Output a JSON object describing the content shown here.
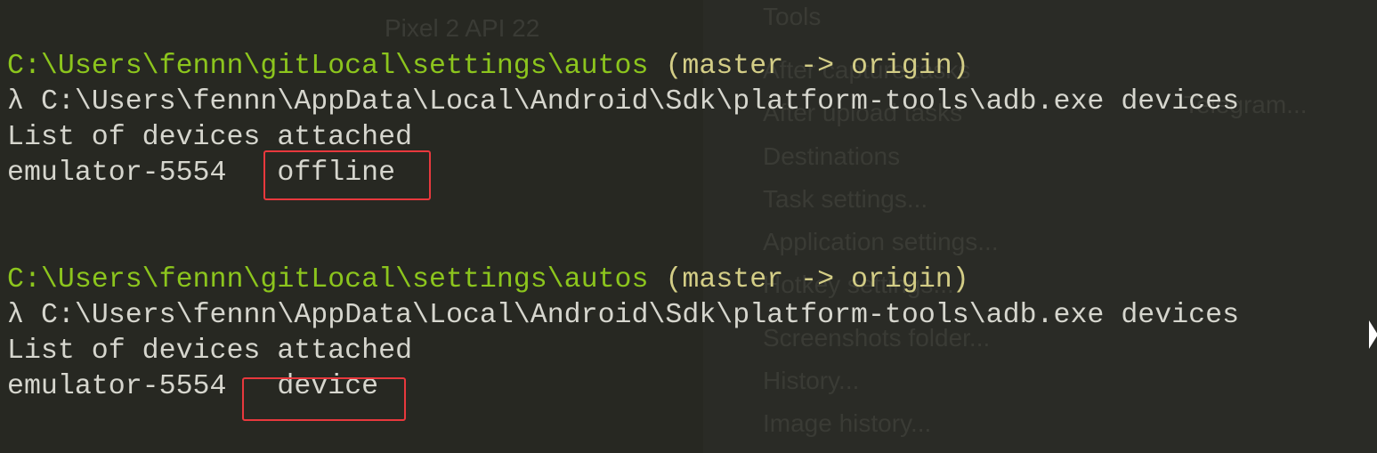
{
  "background_menu": {
    "items": [
      "Tools",
      "After capture tasks",
      "After upload tasks",
      "Destinations",
      "Task settings...",
      "Application settings...",
      "Hotkey settings...",
      "Screenshots folder...",
      "History...",
      "Image history..."
    ],
    "device_label": "Pixel 2 API 22",
    "telegram_label": "Telegram..."
  },
  "terminal": {
    "blocks": [
      {
        "cwd": "C:\\Users\\fennn\\gitLocal\\settings\\autos",
        "branch": "(master -> origin)",
        "prompt": "λ",
        "command": "C:\\Users\\fennn\\AppData\\Local\\Android\\Sdk\\platform-tools\\adb.exe devices",
        "header": "List of devices attached",
        "device": "emulator-5554",
        "state": "offline",
        "sep": "   "
      },
      {
        "cwd": "C:\\Users\\fennn\\gitLocal\\settings\\autos",
        "branch": "(master -> origin)",
        "prompt": "λ",
        "command": "C:\\Users\\fennn\\AppData\\Local\\Android\\Sdk\\platform-tools\\adb.exe devices",
        "header": "List of devices attached",
        "device": "emulator-5554",
        "state": "device",
        "sep": "   "
      }
    ]
  },
  "colors": {
    "background": "#272822",
    "path": "#8cc51d",
    "branch": "#d3cd86",
    "text": "#d6d6ce",
    "highlight": "#e8383d"
  }
}
